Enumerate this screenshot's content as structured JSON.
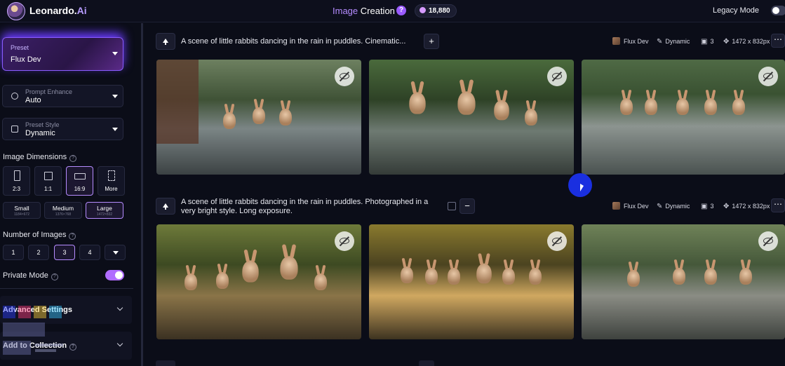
{
  "header": {
    "brand": "Leonardo.",
    "brand_ai": "Ai",
    "title_prefix": "Image",
    "title_main": "Creation",
    "help": "?",
    "tokens": "18,880",
    "legacy_mode_label": "Legacy Mode",
    "legacy_mode_on": false
  },
  "sidebar": {
    "preset": {
      "label": "Preset",
      "value": "Flux Dev"
    },
    "prompt_enhance": {
      "label": "Prompt Enhance",
      "value": "Auto"
    },
    "preset_style": {
      "label": "Preset Style",
      "value": "Dynamic"
    },
    "image_dimensions": {
      "label": "Image Dimensions",
      "ratios": [
        "2:3",
        "1:1",
        "16:9",
        "More"
      ],
      "selected_ratio": "16:9",
      "sizes": [
        {
          "name": "Small",
          "dim": "1184×672"
        },
        {
          "name": "Medium",
          "dim": "1376×768"
        },
        {
          "name": "Large",
          "dim": "1472×832"
        }
      ],
      "selected_size": "Large"
    },
    "number_of_images": {
      "label": "Number of Images",
      "options": [
        "1",
        "2",
        "3",
        "4"
      ],
      "selected": "3"
    },
    "private_mode": {
      "label": "Private Mode",
      "on": true
    },
    "advanced_settings": "Advanced Settings",
    "add_to_collection": "Add to Collection"
  },
  "generations": [
    {
      "prompt": "A scene of little rabbits dancing in the rain in puddles. Cinematic...",
      "model": "Flux Dev",
      "style": "Dynamic",
      "count": "3",
      "size": "1472 x 832px"
    },
    {
      "prompt_line1": "A scene of little rabbits dancing in the rain in puddles. Photographed in a",
      "prompt_line2": "very bright style. Long exposure.",
      "model": "Flux Dev",
      "style": "Dynamic",
      "count": "3",
      "size": "1472 x 832px"
    }
  ],
  "colors": {
    "accent": "#b06cff",
    "background": "#0b0d18",
    "cursor": "#1a2fe0"
  }
}
